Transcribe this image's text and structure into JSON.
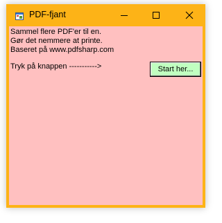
{
  "window": {
    "title": "PDF-fjant",
    "icon": "app-window-icon",
    "controls": {
      "minimize_icon": "minimize-icon",
      "maximize_icon": "maximize-icon",
      "close_icon": "close-icon"
    }
  },
  "colors": {
    "titlebar": "#fdb317",
    "client_background": "#ffc0c0",
    "button_background": "#c0ffc0"
  },
  "content": {
    "lines": [
      "Sammel flere PDF'er til en.",
      "Gør det nemmere at printe.",
      "Baseret på www.pdfsharp.com"
    ],
    "instruction": "Tryk på knappen ----------->",
    "start_button_label": "Start her..."
  }
}
